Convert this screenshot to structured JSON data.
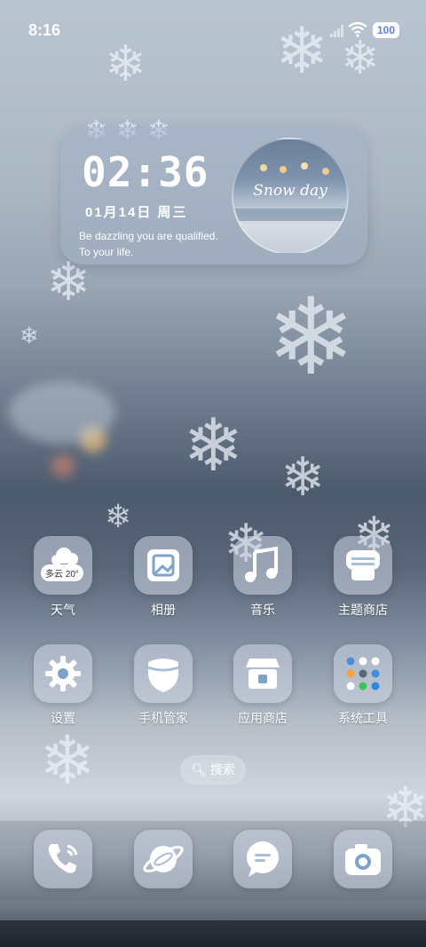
{
  "status_bar": {
    "time": "8:16",
    "battery": "100"
  },
  "widget": {
    "clock": "02:36",
    "date": "01月14日 周三",
    "quote_line1": "Be dazzling  you are qualified.",
    "quote_line2": "To your life.",
    "photo_caption": "Snow day",
    "decor": "❄❄❄"
  },
  "apps": [
    {
      "label": "天气",
      "weather_chip": "多云 20°"
    },
    {
      "label": "相册"
    },
    {
      "label": "音乐"
    },
    {
      "label": "主题商店"
    },
    {
      "label": "设置"
    },
    {
      "label": "手机管家"
    },
    {
      "label": "应用商店"
    },
    {
      "label": "系统工具"
    }
  ],
  "search": {
    "label": "搜索"
  },
  "dock": [
    {
      "name": "phone-icon"
    },
    {
      "name": "browser-icon"
    },
    {
      "name": "messages-icon"
    },
    {
      "name": "camera-icon"
    }
  ],
  "colors": {
    "accent": "#5a7fe0",
    "icon_tint": "#7fa2c8",
    "glass": "#cdd6e4"
  }
}
